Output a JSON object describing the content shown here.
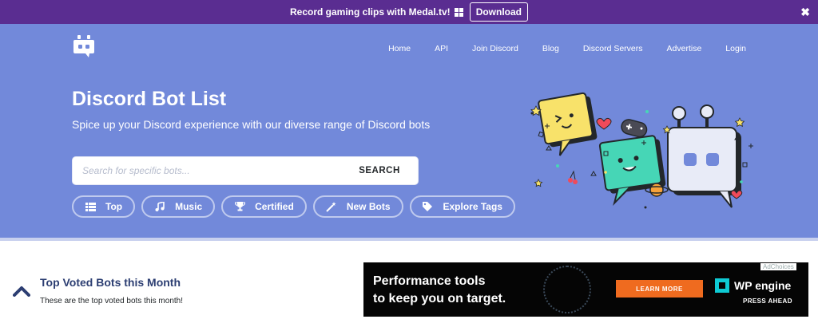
{
  "promo": {
    "text": "Record gaming clips with Medal.tv!",
    "download_label": "Download",
    "close_label": "✖"
  },
  "nav": {
    "items": [
      "Home",
      "API",
      "Join Discord",
      "Blog",
      "Discord Servers",
      "Advertise",
      "Login"
    ]
  },
  "hero": {
    "title": "Discord Bot List",
    "subtitle": "Spice up your Discord experience with our diverse range of Discord bots",
    "search_placeholder": "Search for specific bots...",
    "search_button": "SEARCH"
  },
  "tags": [
    {
      "label": "Top",
      "icon": "list-icon"
    },
    {
      "label": "Music",
      "icon": "music-note-icon"
    },
    {
      "label": "Certified",
      "icon": "trophy-icon"
    },
    {
      "label": "New Bots",
      "icon": "magic-wand-icon"
    },
    {
      "label": "Explore Tags",
      "icon": "tags-icon"
    }
  ],
  "section": {
    "title": "Top Voted Bots this Month",
    "subtitle": "These are the top voted bots this month!"
  },
  "ad": {
    "line1": "Performance tools",
    "line2": "to keep you on target.",
    "cta": "LEARN MORE",
    "brand": "WP engine",
    "tagline": "PRESS AHEAD",
    "adchoices": "AdChoices"
  },
  "colors": {
    "promo_bg": "#5a2d91",
    "hero_bg": "#7289da",
    "accent": "#ef6b1f"
  }
}
